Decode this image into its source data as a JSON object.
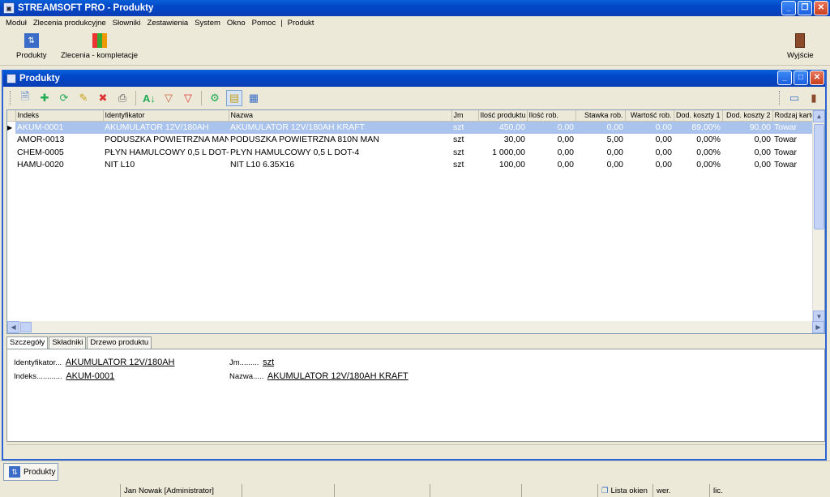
{
  "app": {
    "title": "STREAMSOFT PRO - Produkty",
    "window_buttons": [
      "minimize-icon",
      "restore-icon",
      "close-icon"
    ]
  },
  "menu": {
    "items": [
      "Moduł",
      "Zlecenia produkcyjne",
      "Słowniki",
      "Zestawienia",
      "System",
      "Okno",
      "Pomoc"
    ],
    "separator": "|",
    "context_item": "Produkt"
  },
  "bigtoolbar": {
    "produkty": "Produkty",
    "zlecenia": "Zlecenia - kompletacje",
    "wyjscie": "Wyjście"
  },
  "inner": {
    "title": "Produkty",
    "toolbar_icons": [
      "view-icon",
      "add-icon",
      "refresh-icon",
      "edit-icon",
      "delete-icon",
      "print-icon",
      "sort-icon",
      "filter-icon",
      "clear-filter-icon",
      "settings-icon",
      "tree-view-icon",
      "calculator-icon",
      "layout-icon",
      "exit-icon"
    ]
  },
  "grid": {
    "columns": [
      "Indeks",
      "Identyfikator",
      "Nazwa",
      "Jm",
      "Ilość produktu",
      "Ilość rob.",
      "Stawka rob.",
      "Wartość rob.",
      "Dod. koszty 1",
      "Dod. koszty 2",
      "Rodzaj kartoteki"
    ],
    "rows": [
      [
        "AKUM-0001",
        "AKUMULATOR 12V/180AH",
        "AKUMULATOR 12V/180AH KRAFT",
        "szt",
        "450,00",
        "0,00",
        "0,00",
        "0,00",
        "89,00%",
        "90,00",
        "Towar"
      ],
      [
        "AMOR-0013",
        "PODUSZKA POWIETRZNA MAN",
        "PODUSZKA POWIETRZNA 810N MAN",
        "szt",
        "30,00",
        "0,00",
        "5,00",
        "0,00",
        "0,00%",
        "0,00",
        "Towar"
      ],
      [
        "CHEM-0005",
        "PŁYN HAMULCOWY 0,5 L DOT-4",
        "PŁYN HAMULCOWY 0,5 L DOT-4",
        "szt",
        "1 000,00",
        "0,00",
        "0,00",
        "0,00",
        "0,00%",
        "0,00",
        "Towar"
      ],
      [
        "HAMU-0020",
        "NIT L10",
        "NIT L10 6.35X16",
        "szt",
        "100,00",
        "0,00",
        "0,00",
        "0,00",
        "0,00%",
        "0,00",
        "Towar"
      ]
    ],
    "selected_row": 0
  },
  "details": {
    "tabs": [
      "Szczegóły",
      "Składniki",
      "Drzewo produktu"
    ],
    "active_tab": 0,
    "identyfikator_label": "Identyfikator...",
    "identyfikator_value": "AKUMULATOR 12V/180AH",
    "indeks_label": "Indeks............",
    "indeks_value": "AKUM-0001",
    "jm_label": "Jm.........",
    "jm_value": "szt",
    "nazwa_label": "Nazwa.....",
    "nazwa_value": "AKUMULATOR 12V/180AH KRAFT"
  },
  "taskbar": {
    "button": "Produkty"
  },
  "status": {
    "user": "Jan Nowak [Administrator]",
    "windows_list": "Lista okien",
    "wer": "wer.",
    "lic": "lic."
  }
}
